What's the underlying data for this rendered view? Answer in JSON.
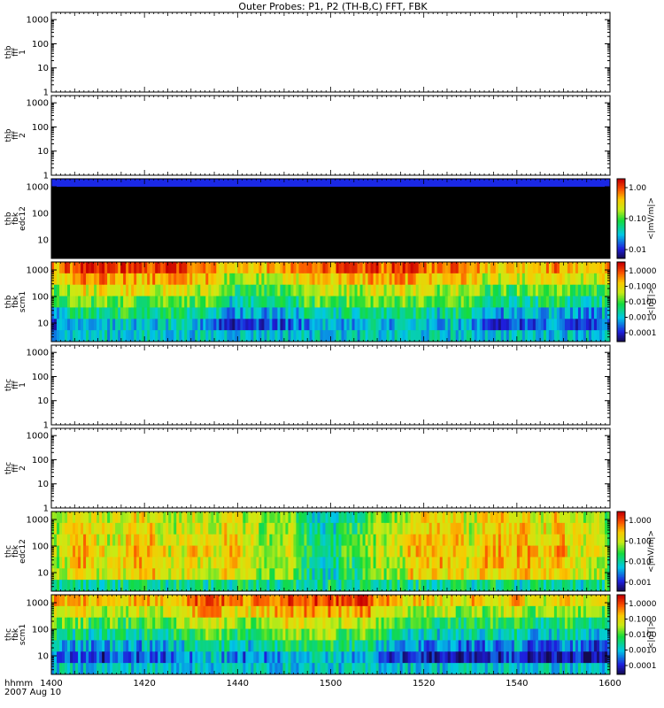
{
  "title": "Outer Probes: P1, P2 (TH-B,C) FFT, FBK",
  "xaxis": {
    "ticks": [
      "1400",
      "1420",
      "1440",
      "1500",
      "1520",
      "1540",
      "1600"
    ],
    "label_line1": "hhmm",
    "label_line2": "2007 Aug 10"
  },
  "chart_data": {
    "type": "heatmap",
    "title": "Outer Probes: P1, P2 (TH-B,C) FFT, FBK",
    "x_range": [
      "1400",
      "1600"
    ],
    "y_scale": "log",
    "grid": false,
    "panels": [
      {
        "ylabel": [
          "thb",
          "fff",
          "1"
        ],
        "yticks": [
          "1000",
          "100",
          "10",
          "1"
        ],
        "ylim": [
          1,
          2000
        ],
        "content": "empty",
        "colorbar": null
      },
      {
        "ylabel": [
          "thb",
          "fff",
          "2"
        ],
        "yticks": [
          "1000",
          "100",
          "10",
          "1"
        ],
        "ylim": [
          1,
          2000
        ],
        "content": "empty",
        "colorbar": null
      },
      {
        "ylabel": [
          "thb",
          "fbk",
          "edc12"
        ],
        "yticks": [
          "1000",
          "100",
          "10"
        ],
        "ylim": [
          2,
          2000
        ],
        "content": "black-with-blue-top",
        "colorbar": {
          "unit": "<|mV/m|>",
          "ticks": [
            "1.00",
            "0.10",
            "0.01"
          ]
        }
      },
      {
        "ylabel": [
          "thb",
          "fbk",
          "scm1"
        ],
        "yticks": [
          "1000",
          "100",
          "10"
        ],
        "ylim": [
          2,
          2000
        ],
        "content": "spectrogram",
        "colorbar": {
          "unit": "<|nT|>",
          "ticks": [
            "1.0000",
            "0.1000",
            "0.0100",
            "0.0010",
            "0.0001"
          ]
        }
      },
      {
        "ylabel": [
          "thc",
          "fff",
          "1"
        ],
        "yticks": [
          "1000",
          "100",
          "10",
          "1"
        ],
        "ylim": [
          1,
          2000
        ],
        "content": "empty",
        "colorbar": null
      },
      {
        "ylabel": [
          "thc",
          "fff",
          "2"
        ],
        "yticks": [
          "1000",
          "100",
          "10",
          "1"
        ],
        "ylim": [
          1,
          2000
        ],
        "content": "empty",
        "colorbar": null
      },
      {
        "ylabel": [
          "thc",
          "fbk",
          "edc12"
        ],
        "yticks": [
          "1000",
          "100",
          "10"
        ],
        "ylim": [
          2,
          2000
        ],
        "content": "spectrogram",
        "colorbar": {
          "unit": "<|mV/m|>",
          "ticks": [
            "1.000",
            "0.100",
            "0.010",
            "0.001"
          ]
        }
      },
      {
        "ylabel": [
          "thc",
          "fbk",
          "scm1"
        ],
        "yticks": [
          "1000",
          "100",
          "10"
        ],
        "ylim": [
          2,
          2000
        ],
        "content": "spectrogram",
        "colorbar": {
          "unit": "<|nT|>",
          "ticks": [
            "1.0000",
            "0.1000",
            "0.0100",
            "0.0010",
            "0.0001"
          ]
        }
      }
    ]
  }
}
